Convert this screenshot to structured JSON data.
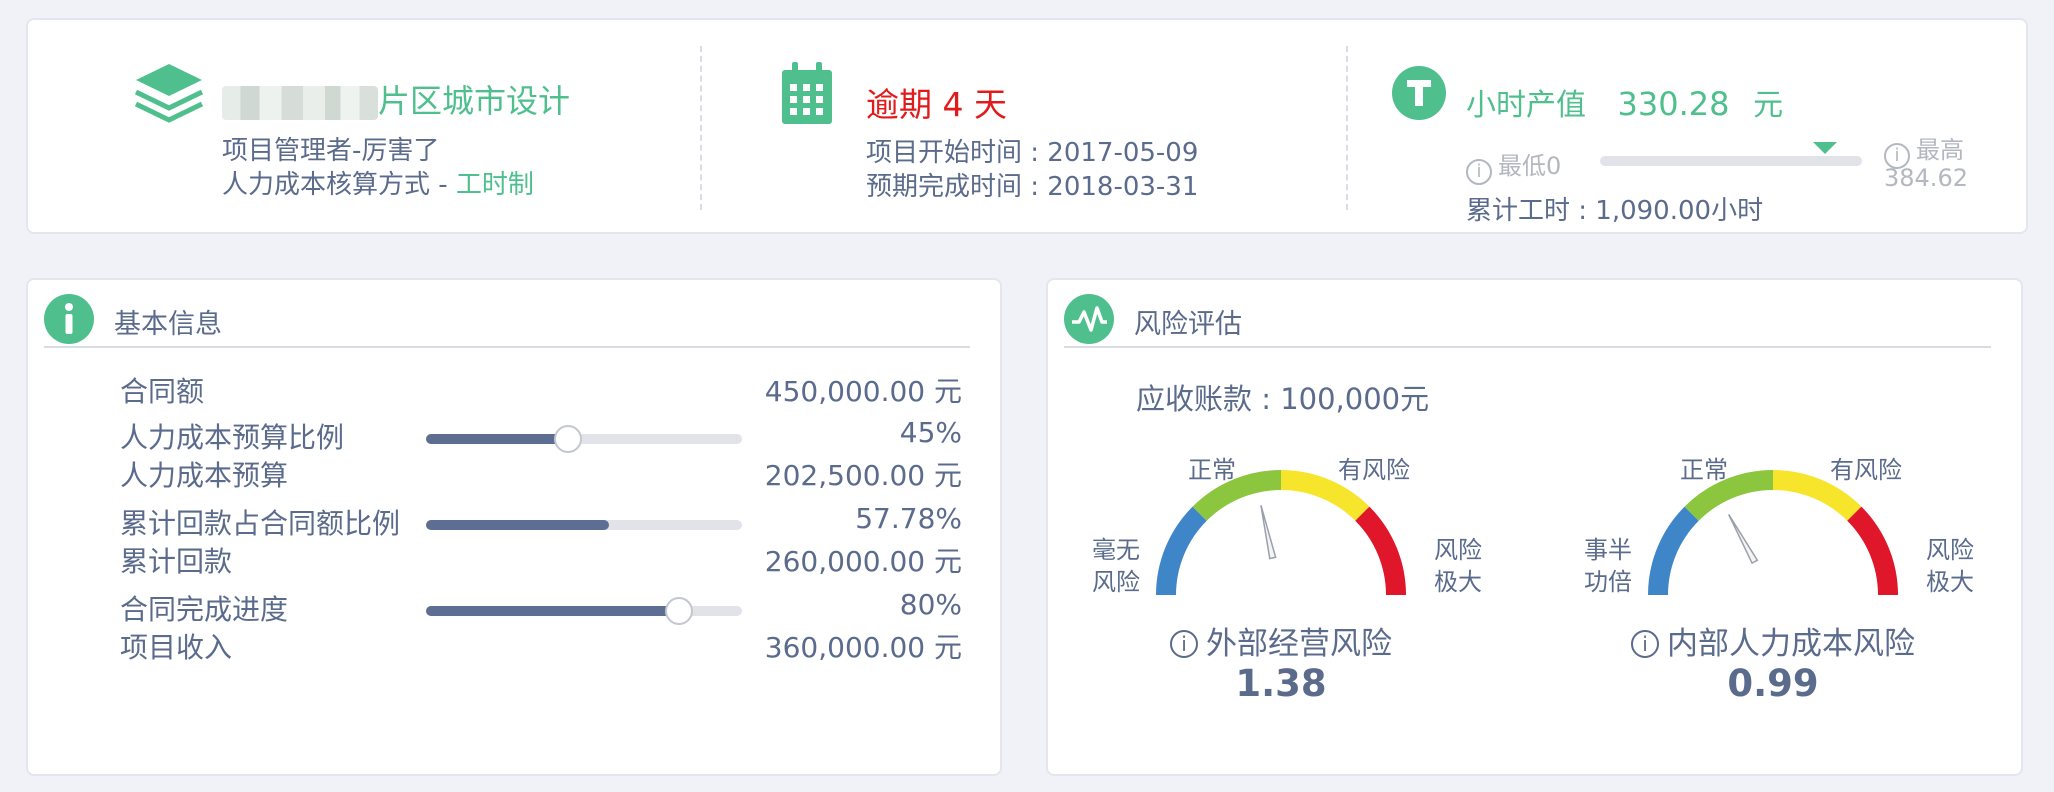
{
  "project": {
    "name_suffix": "片区城市设计",
    "manager": "项目管理者-厉害了",
    "cost_method_prefix": "人力成本核算方式 - ",
    "cost_method": "工时制"
  },
  "schedule": {
    "status": "逾期 4 天",
    "start": "项目开始时间 : 2017-05-09",
    "end": "预期完成时间 : 2018-03-31"
  },
  "hourly": {
    "label": "小时产值",
    "value": "330.28",
    "unit": "元",
    "min_label": "最低0",
    "max_label": "最高",
    "max_value": "384.62",
    "level": 0.86,
    "total_hours": "累计工时 : 1,090.00小时"
  },
  "basic": {
    "title": "基本信息",
    "rows": [
      {
        "label": "合同额",
        "value": "450,000.00 元"
      },
      {
        "label": "人力成本预算比例",
        "value": "45%",
        "percent": 45,
        "knob": true
      },
      {
        "label": "人力成本预算",
        "value": "202,500.00 元"
      },
      {
        "label": "累计回款占合同额比例",
        "value": "57.78%",
        "percent": 57.78,
        "knob": false
      },
      {
        "label": "累计回款",
        "value": "260,000.00 元"
      },
      {
        "label": "合同完成进度",
        "value": "80%",
        "percent": 80,
        "knob": true
      },
      {
        "label": "项目收入",
        "value": "360,000.00 元"
      }
    ]
  },
  "risk": {
    "title": "风险评估",
    "receivable": "应收账款 : 100,000元",
    "gauges": [
      {
        "left_label_1": "毫无",
        "left_label_2": "风险",
        "top_left": "正常",
        "top_right": "有风险",
        "right_label_1": "风险",
        "right_label_2": "极大",
        "name": "外部经营风险",
        "value": "1.38",
        "needle_fraction": 0.43
      },
      {
        "left_label_1": "事半",
        "left_label_2": "功倍",
        "top_left": "正常",
        "top_right": "有风险",
        "right_label_1": "风险",
        "right_label_2": "极大",
        "name": "内部人力成本风险",
        "value": "0.99",
        "needle_fraction": 0.34
      }
    ]
  },
  "colors": {
    "green": "#4fbf8d",
    "red": "#e11b1b",
    "text": "#5b6b8c",
    "gauge_blue": "#3f86c9",
    "gauge_green": "#8cc63e",
    "gauge_yellow": "#f7e52c",
    "gauge_red": "#e0162b"
  }
}
